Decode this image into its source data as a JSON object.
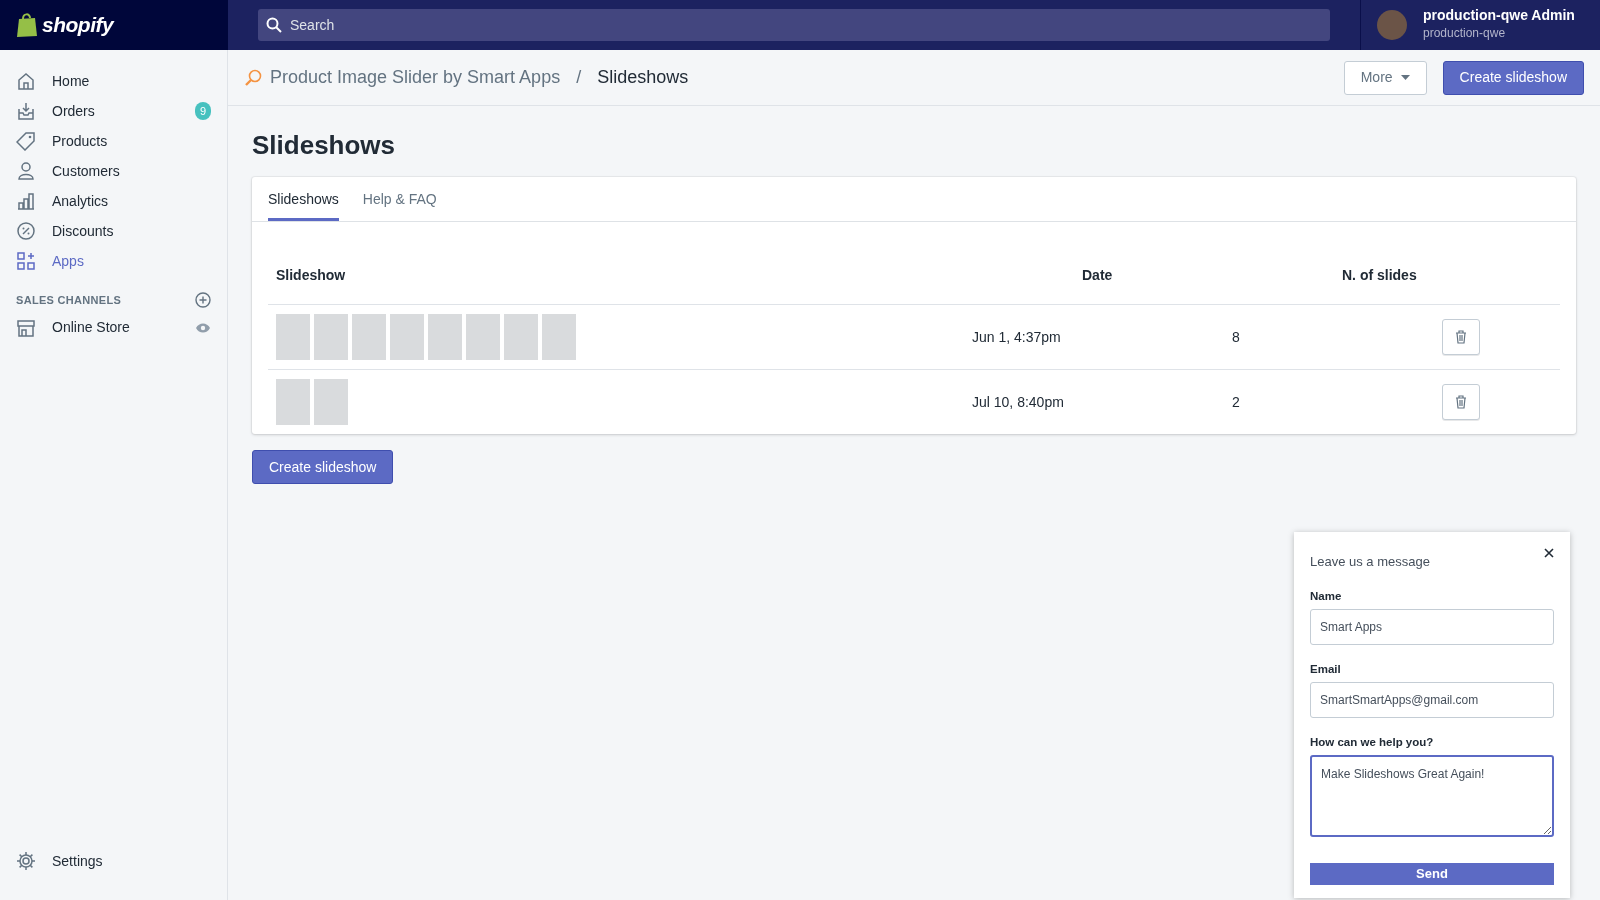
{
  "topbar": {
    "logo": "shopify",
    "search": {
      "placeholder": "Search"
    },
    "user": {
      "name": "production-qwe Admin",
      "store": "production-qwe"
    }
  },
  "sidebar": {
    "items": [
      {
        "label": "Home",
        "kind": "home",
        "selected": false
      },
      {
        "label": "Orders",
        "kind": "orders",
        "selected": false,
        "badge": "9"
      },
      {
        "label": "Products",
        "kind": "tag",
        "selected": false
      },
      {
        "label": "Customers",
        "kind": "person",
        "selected": false
      },
      {
        "label": "Analytics",
        "kind": "chart",
        "selected": false
      },
      {
        "label": "Discounts",
        "kind": "discount",
        "selected": false
      },
      {
        "label": "Apps",
        "kind": "apps",
        "selected": true
      }
    ],
    "section": "SALES CHANNELS",
    "channels": [
      {
        "label": "Online Store",
        "kind": "store",
        "selected": false
      }
    ],
    "footer": {
      "label": "Settings",
      "kind": "gear",
      "selected": false
    }
  },
  "header": {
    "breadcrumb": [
      "Product Image Slider by Smart Apps",
      "Slideshows"
    ],
    "separator": "/",
    "buttons": [
      {
        "label": "More",
        "kind": "dropdown"
      },
      {
        "label": "Create slideshow",
        "kind": "primary"
      }
    ]
  },
  "page": {
    "title": "Slideshows",
    "tabs": [
      {
        "label": "Slideshows",
        "selected": true
      },
      {
        "label": "Help & FAQ",
        "selected": false
      }
    ],
    "table": {
      "columns": [
        "Slideshow",
        "Date",
        "N. of slides"
      ],
      "rows": [
        {
          "thumbnails": [
            {
              "kind": "photo"
            },
            {
              "kind": "photo"
            },
            {
              "kind": "photo"
            },
            {
              "kind": "photo"
            },
            {
              "kind": "photo"
            },
            {
              "kind": "photo"
            },
            {
              "kind": "photo"
            },
            {
              "kind": "photo"
            }
          ],
          "date": "Jun 1, 4:37pm",
          "slides": "8"
        },
        {
          "thumbnails": [
            {
              "kind": "photo"
            },
            {
              "kind": "photo"
            }
          ],
          "date": "Jul 10, 8:40pm",
          "slides": "2"
        }
      ]
    },
    "button": "Create slideshow"
  },
  "chat": {
    "title": "Leave us a message",
    "fields": [
      {
        "label": "Name",
        "value": "Smart Apps",
        "kind": "input",
        "focused": false
      },
      {
        "label": "Email",
        "value": "SmartSmartApps@gmail.com",
        "kind": "input",
        "focused": false
      },
      {
        "label": "How can we help you?",
        "value": "Make Slideshows Great Again!",
        "kind": "textarea",
        "focused": true
      }
    ],
    "button": "Send"
  }
}
